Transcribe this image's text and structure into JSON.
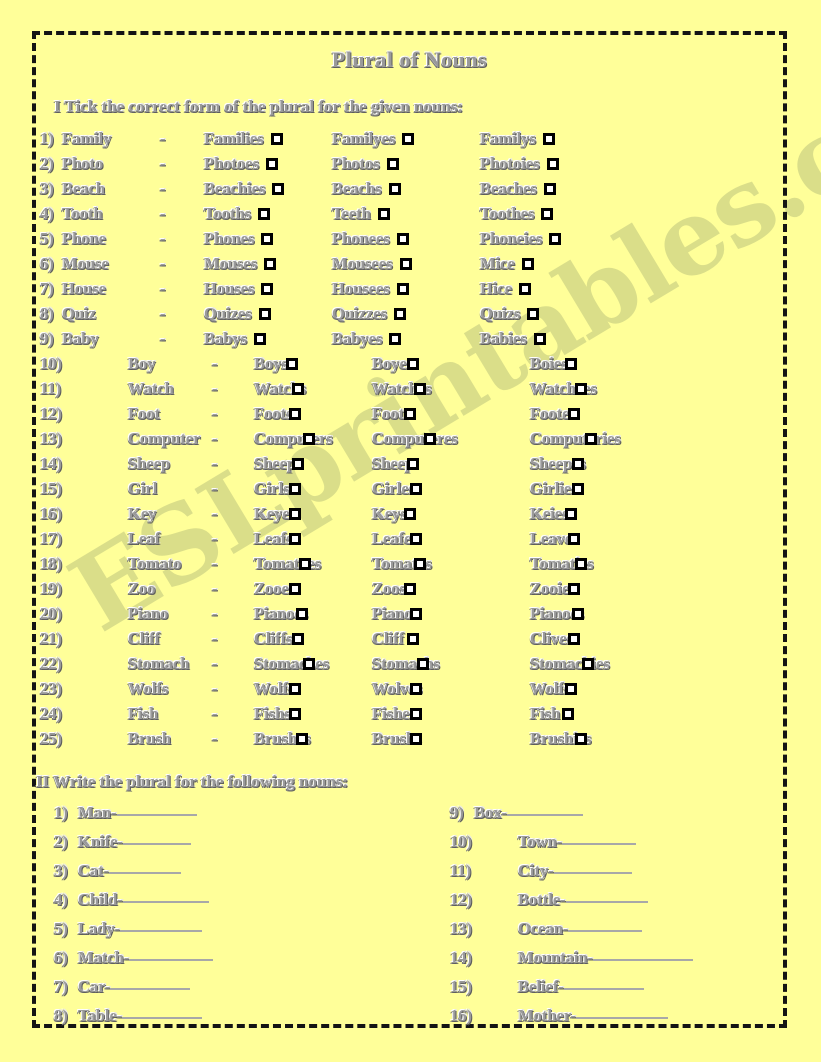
{
  "page": {
    "background_color": "#ffff99",
    "border_color": "#141414",
    "text_color": "#9a9a9a",
    "watermark": "ESLprintables.com"
  },
  "title": "Plural of Nouns",
  "section1": {
    "heading": "I Tick the correct form of the plural for the given nouns:",
    "dash": "-",
    "rows": [
      {
        "num": "1)",
        "noun": "Family",
        "options": [
          "Families",
          "Familyes",
          "Familys"
        ]
      },
      {
        "num": "2)",
        "noun": "Photo",
        "options": [
          "Photoes",
          "Photos",
          "Photoies"
        ]
      },
      {
        "num": "3)",
        "noun": "Beach",
        "options": [
          "Beachies",
          "Beachs",
          "Beaches"
        ]
      },
      {
        "num": "4)",
        "noun": "Tooth",
        "options": [
          "Tooths",
          "Teeth",
          "Toothes"
        ]
      },
      {
        "num": "5)",
        "noun": "Phone",
        "options": [
          "Phones",
          "Phonees",
          "Phoneies"
        ]
      },
      {
        "num": "6)",
        "noun": "Mouse",
        "options": [
          "Mouses",
          "Mousees",
          "Mice"
        ]
      },
      {
        "num": "7)",
        "noun": "House",
        "options": [
          "Houses",
          "Housees",
          "Hice"
        ]
      },
      {
        "num": "8)",
        "noun": "Quiz",
        "options": [
          "Quizes",
          "Quizzes",
          "Quizs"
        ]
      },
      {
        "num": "9)",
        "noun": "Baby",
        "options": [
          "Babys",
          "Babyes",
          "Babies"
        ]
      },
      {
        "num": "10)",
        "noun": "Boy",
        "options": [
          "Boys",
          "Boyes",
          "Boies"
        ]
      },
      {
        "num": "11)",
        "noun": "Watch",
        "options": [
          "Watchs",
          "Watches",
          "Watchees"
        ]
      },
      {
        "num": "12)",
        "noun": "Foot",
        "options": [
          "Foots",
          "Foot",
          "Footes"
        ]
      },
      {
        "num": "13)",
        "noun": "Computer",
        "options": [
          "Computers",
          "Computeres",
          "Computeries"
        ]
      },
      {
        "num": "14)",
        "noun": "Sheep",
        "options": [
          "Sheeps",
          "Sheep",
          "Sheepes"
        ]
      },
      {
        "num": "15)",
        "noun": "Girl",
        "options": [
          "Girls",
          "Girles",
          "Girlies"
        ]
      },
      {
        "num": "16)",
        "noun": "Key",
        "options": [
          "Keyes",
          "Keys",
          "Keies"
        ]
      },
      {
        "num": "17)",
        "noun": "Leaf",
        "options": [
          "Leafs",
          "Leafes",
          "Leaves"
        ]
      },
      {
        "num": "18)",
        "noun": "Tomato",
        "options": [
          "Tomatoes",
          "Tomatos",
          "Tomaties"
        ]
      },
      {
        "num": "19)",
        "noun": "Zoo",
        "options": [
          "Zooes",
          "Zoos",
          "Zooies"
        ]
      },
      {
        "num": "20)",
        "noun": "Piano",
        "options": [
          "Pianoes",
          "Pianos",
          "Pianoes"
        ]
      },
      {
        "num": "21)",
        "noun": "Cliff",
        "options": [
          "Cliffs",
          "Cliff",
          "Clives"
        ]
      },
      {
        "num": "22)",
        "noun": "Stomach",
        "options": [
          "Stomaches",
          "Stomachs",
          "Stomachies"
        ]
      },
      {
        "num": "23)",
        "noun": "Wolfs",
        "options": [
          "Wolfs",
          "Wolves",
          "Wolfs"
        ]
      },
      {
        "num": "24)",
        "noun": "Fish",
        "options": [
          "Fishs",
          "Fishes",
          "Fish"
        ]
      },
      {
        "num": "25)",
        "noun": "Brush",
        "options": [
          "Brushes",
          "Brushs",
          "Brushies"
        ]
      }
    ]
  },
  "section2": {
    "heading": "II Write the plural for the following nouns:",
    "left": [
      {
        "num": "1)",
        "noun": "Man-"
      },
      {
        "num": "2)",
        "noun": "Knife-"
      },
      {
        "num": "3)",
        "noun": "Cat-"
      },
      {
        "num": "4)",
        "noun": "Child-"
      },
      {
        "num": "5)",
        "noun": "Lady-"
      },
      {
        "num": "6)",
        "noun": "Match-"
      },
      {
        "num": "7)",
        "noun": "Car-"
      },
      {
        "num": "8)",
        "noun": "Table-"
      }
    ],
    "right": [
      {
        "num": "9)",
        "noun": "Box-"
      },
      {
        "num": "10)",
        "noun": "Town-"
      },
      {
        "num": "11)",
        "noun": "City-"
      },
      {
        "num": "12)",
        "noun": "Bottle-"
      },
      {
        "num": "13)",
        "noun": "Ocean-"
      },
      {
        "num": "14)",
        "noun": "Mountain-"
      },
      {
        "num": "15)",
        "noun": "Belief-"
      },
      {
        "num": "16)",
        "noun": "Mother-"
      }
    ]
  }
}
